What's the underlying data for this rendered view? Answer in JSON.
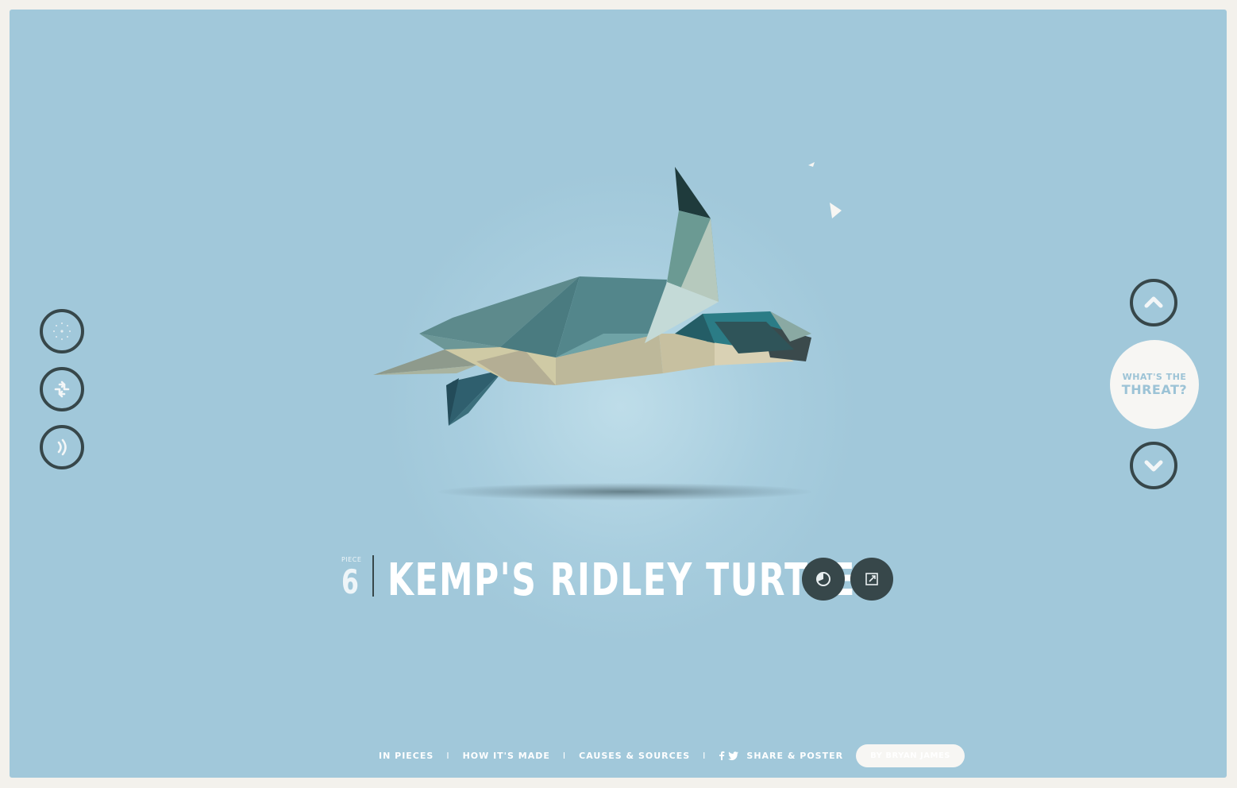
{
  "page": {
    "background_color": "#a1c8da",
    "frame_color": "#f3f1ec",
    "accent_dark": "#37474a"
  },
  "left_controls": [
    {
      "name": "stars-view",
      "icon": "dots-circle-icon"
    },
    {
      "name": "shuffle",
      "icon": "shuffle-arrows-icon"
    },
    {
      "name": "sound",
      "icon": "sound-waves-icon"
    }
  ],
  "right_controls": {
    "up_icon": "chevron-up-icon",
    "down_icon": "chevron-down-icon",
    "threat_line1": "WHAT'S THE",
    "threat_line2": "THREAT?"
  },
  "title": {
    "piece_label": "PIECE",
    "piece_number": "6",
    "species": "KEMP'S RIDLEY TURTLE",
    "action_icons": [
      "stats-pie-icon",
      "external-link-icon"
    ]
  },
  "footer": {
    "links": [
      "IN PIECES",
      "HOW IT'S MADE",
      "CAUSES & SOURCES"
    ],
    "separator": "I",
    "share": "SHARE & POSTER",
    "social_icons": [
      "facebook-icon",
      "twitter-icon"
    ],
    "byline": "BY BRYAN JAMES"
  }
}
